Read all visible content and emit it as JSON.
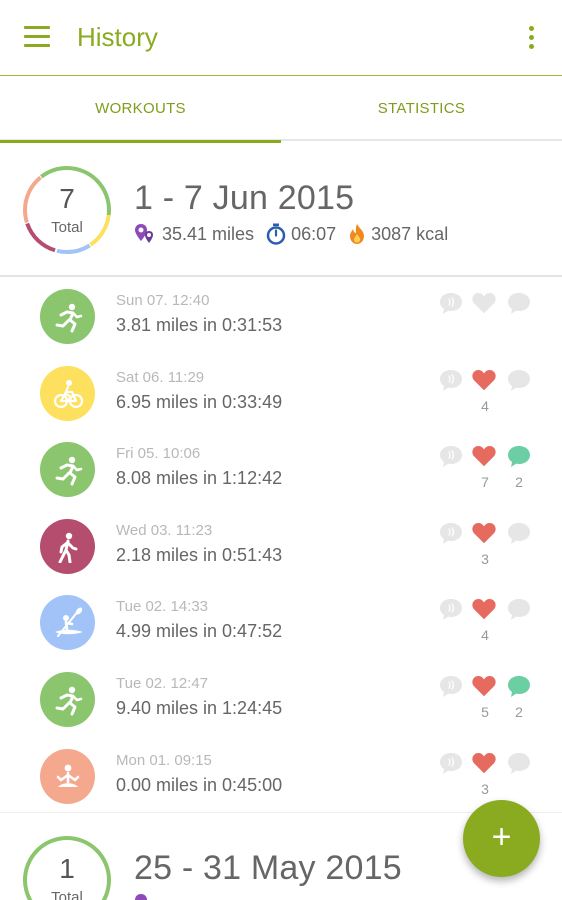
{
  "appbar": {
    "title": "History"
  },
  "tabs": {
    "workouts": "WORKOUTS",
    "statistics": "STATISTICS",
    "active": "workouts"
  },
  "colors": {
    "accent": "#8aab1f",
    "running": "#8bc56e",
    "cycling": "#fde05d",
    "walking": "#b54d6e",
    "kayaking": "#a2c3f7",
    "yoga": "#f4a98f",
    "heart": "#e66a5e",
    "comment": "#6ccfa3",
    "inactive": "#e6e6e6"
  },
  "weeks": [
    {
      "count": "7",
      "count_label": "Total",
      "range": "1 - 7 Jun 2015",
      "distance": "35.41 miles",
      "duration": "06:07",
      "calories": "3087 kcal"
    },
    {
      "count": "1",
      "count_label": "Total",
      "range": "25 - 31 May 2015",
      "distance": "",
      "duration": "",
      "calories": ""
    }
  ],
  "workouts": [
    {
      "sport": "running-icon",
      "color": "running",
      "date": "Sun 07. 12:40",
      "summary": "3.81 miles in 0:31:53",
      "likes": "",
      "comments": "",
      "liked": false,
      "commented": false
    },
    {
      "sport": "cycling-icon",
      "color": "cycling",
      "date": "Sat 06. 11:29",
      "summary": "6.95 miles in 0:33:49",
      "likes": "4",
      "comments": "",
      "liked": true,
      "commented": false
    },
    {
      "sport": "running-icon",
      "color": "running",
      "date": "Fri 05. 10:06",
      "summary": "8.08 miles in 1:12:42",
      "likes": "7",
      "comments": "2",
      "liked": true,
      "commented": true
    },
    {
      "sport": "walking-icon",
      "color": "walking",
      "date": "Wed 03. 11:23",
      "summary": "2.18 miles in 0:51:43",
      "likes": "3",
      "comments": "",
      "liked": true,
      "commented": false
    },
    {
      "sport": "kayaking-icon",
      "color": "kayaking",
      "date": "Tue 02. 14:33",
      "summary": "4.99 miles in 0:47:52",
      "likes": "4",
      "comments": "",
      "liked": true,
      "commented": false
    },
    {
      "sport": "running-icon",
      "color": "running",
      "date": "Tue 02. 12:47",
      "summary": "9.40 miles in 1:24:45",
      "likes": "5",
      "comments": "2",
      "liked": true,
      "commented": true
    },
    {
      "sport": "yoga-icon",
      "color": "yoga",
      "date": "Mon 01. 09:15",
      "summary": "0.00 miles in 0:45:00",
      "likes": "3",
      "comments": "",
      "liked": true,
      "commented": false
    }
  ],
  "fab": {
    "label": "+"
  }
}
